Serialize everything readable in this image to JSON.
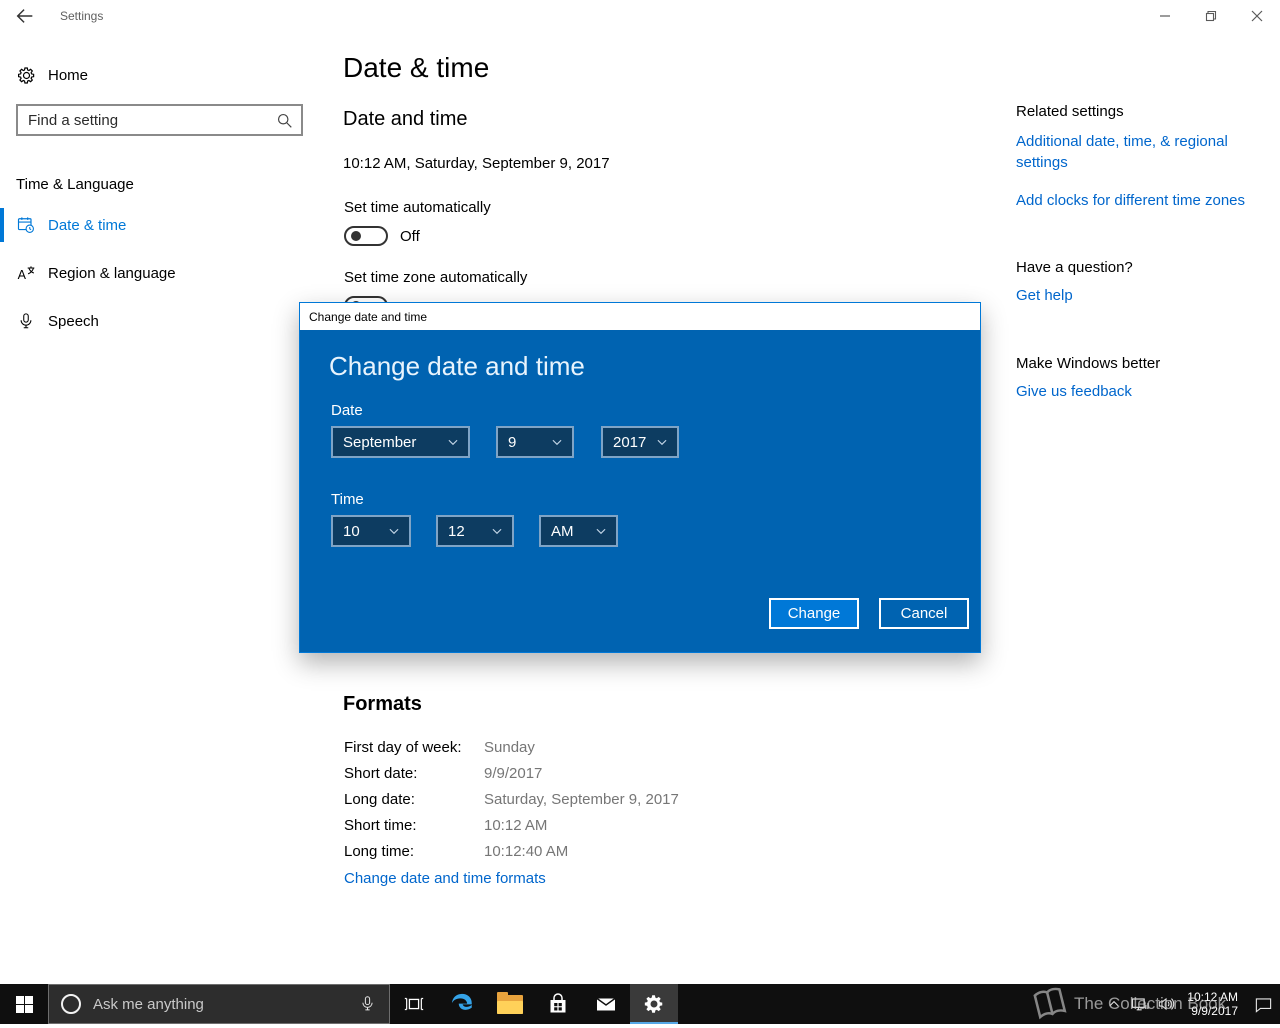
{
  "titlebar": {
    "title": "Settings"
  },
  "sidebar": {
    "home_label": "Home",
    "search_placeholder": "Find a setting",
    "section_label": "Time & Language",
    "items": [
      {
        "label": "Date & time"
      },
      {
        "label": "Region & language"
      },
      {
        "label": "Speech"
      }
    ]
  },
  "main": {
    "page_title": "Date & time",
    "section_title": "Date and time",
    "current_datetime": "10:12 AM, Saturday, September 9, 2017",
    "set_time_label": "Set time automatically",
    "set_time_state": "Off",
    "set_zone_label": "Set time zone automatically"
  },
  "dialog": {
    "titlebar": "Change date and time",
    "heading": "Change date and time",
    "date_label": "Date",
    "month": "September",
    "day": "9",
    "year": "2017",
    "time_label": "Time",
    "hour": "10",
    "minute": "12",
    "ampm": "AM",
    "change_button": "Change",
    "cancel_button": "Cancel"
  },
  "formats": {
    "heading": "Formats",
    "rows": [
      {
        "label": "First day of week:",
        "value": "Sunday"
      },
      {
        "label": "Short date:",
        "value": "9/9/2017"
      },
      {
        "label": "Long date:",
        "value": "Saturday, September 9, 2017"
      },
      {
        "label": "Short time:",
        "value": "10:12 AM"
      },
      {
        "label": "Long time:",
        "value": "10:12:40 AM"
      }
    ],
    "link": "Change date and time formats"
  },
  "related": {
    "heading": "Related settings",
    "link1": "Additional date, time, & regional settings",
    "link2": "Add clocks for different time zones",
    "question_heading": "Have a question?",
    "question_link": "Get help",
    "better_heading": "Make Windows better",
    "better_link": "Give us feedback"
  },
  "taskbar": {
    "search_placeholder": "Ask me anything",
    "tray_time": "10:12 AM",
    "tray_date": "9/9/2017",
    "watermark": "The Collection Book"
  },
  "colors": {
    "accent": "#0078d7",
    "dialog_bg": "#0063b1",
    "link": "#0066cc",
    "taskbar_bg": "#0f0f0f"
  }
}
